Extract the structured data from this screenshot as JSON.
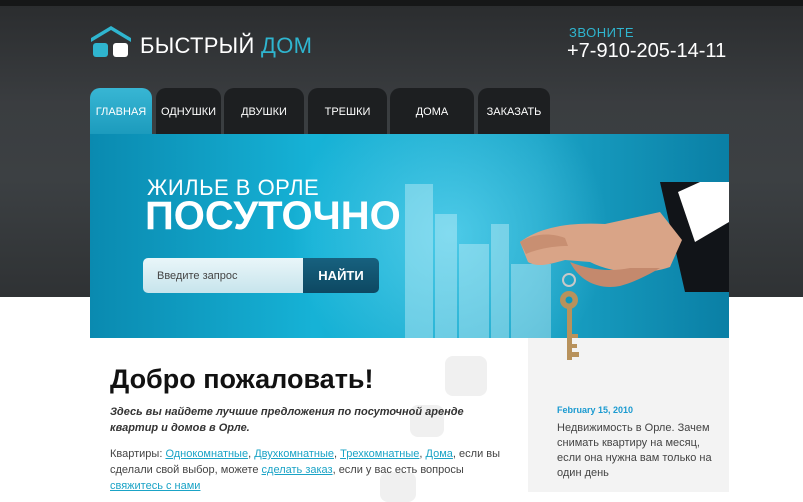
{
  "logo": {
    "name_part1": "БЫСТРЫЙ",
    "name_part2": "ДОМ"
  },
  "phone": {
    "label": "ЗВОНИТЕ",
    "number": "+7-910-205-14-11"
  },
  "nav": {
    "items": [
      {
        "label": "ГЛАВНАЯ",
        "active": true
      },
      {
        "label": "ОДНУШКИ"
      },
      {
        "label": "ДВУШКИ"
      },
      {
        "label": "ТРЕШКИ"
      },
      {
        "label": "ДОМА"
      },
      {
        "label": "ЗАКАЗАТЬ"
      }
    ]
  },
  "banner": {
    "line1": "ЖИЛЬЕ В ОРЛЕ",
    "line2": "ПОСУТОЧНО",
    "search_placeholder": "Введите запрос",
    "search_button": "НАЙТИ"
  },
  "content": {
    "title": "Добро пожаловать!",
    "intro": "Здесь вы найдете лучшие предложения по посуточной аренде квартир и домов в Орле.",
    "body": {
      "prefix": "Квартиры: ",
      "link1": "Однокомнатные",
      "sep1": ", ",
      "link2": "Двухкомнатные",
      "sep2": ", ",
      "link3": "Трехкомнатные",
      "sep3": ", ",
      "link4": "Дома",
      "mid1": ", если вы сделали свой выбор, можете ",
      "link5": "сделать заказ",
      "mid2": ", если у вас есть вопросы ",
      "link6": "свяжитесь с нами"
    }
  },
  "sidebar": {
    "news_date": "February 15, 2010",
    "news_text": "Недвижимость в Орле. Зачем снимать квартиру на месяц, если она нужна вам только на один день"
  },
  "colors": {
    "accent": "#2fb5cf",
    "header_dark": "#2a2c2e",
    "banner": "#16b2d6",
    "link": "#1aa3c6",
    "date": "#1a9ad0"
  }
}
